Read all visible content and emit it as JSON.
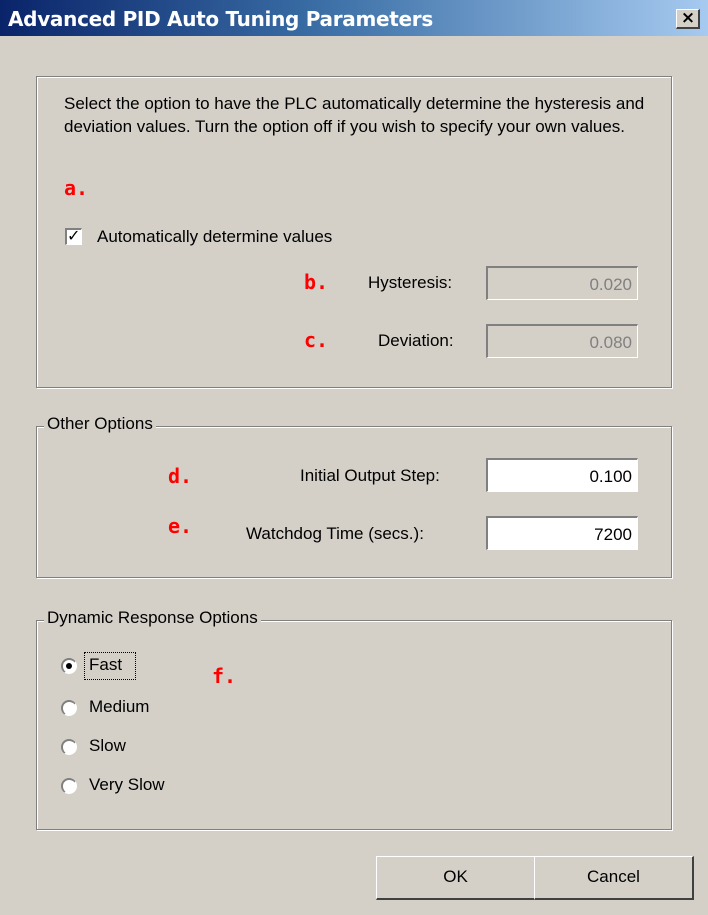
{
  "window": {
    "title": "Advanced PID Auto Tuning Parameters",
    "close_glyph": "×"
  },
  "auto_group": {
    "description": "Select the option to have the PLC automatically determine the hysteresis and deviation values.  Turn the option off if you wish to specify your own values.",
    "checkbox_label": "Automatically determine values",
    "checked": true,
    "hysteresis_label": "Hysteresis:",
    "hysteresis_value": "0.020",
    "deviation_label": "Deviation:",
    "deviation_value": "0.080"
  },
  "other_options": {
    "legend": "Other Options",
    "initial_step_label": "Initial Output Step:",
    "initial_step_value": "0.100",
    "watchdog_label": "Watchdog Time (secs.):",
    "watchdog_value": "7200"
  },
  "dynamic_response": {
    "legend": "Dynamic Response Options",
    "options": [
      {
        "label": "Fast",
        "selected": true
      },
      {
        "label": "Medium",
        "selected": false
      },
      {
        "label": "Slow",
        "selected": false
      },
      {
        "label": "Very Slow",
        "selected": false
      }
    ]
  },
  "markers": {
    "a": "a.",
    "b": "b.",
    "c": "c.",
    "d": "d.",
    "e": "e.",
    "f": "f."
  },
  "buttons": {
    "ok": "OK",
    "cancel": "Cancel"
  },
  "colors": {
    "marker": "#ff0000",
    "face": "#d4d0c8",
    "title_start": "#0a246a",
    "title_end": "#a6caf0"
  },
  "icons": {
    "close": "close-icon",
    "check": "checkmark-icon",
    "radio": "radio-dot-icon"
  }
}
